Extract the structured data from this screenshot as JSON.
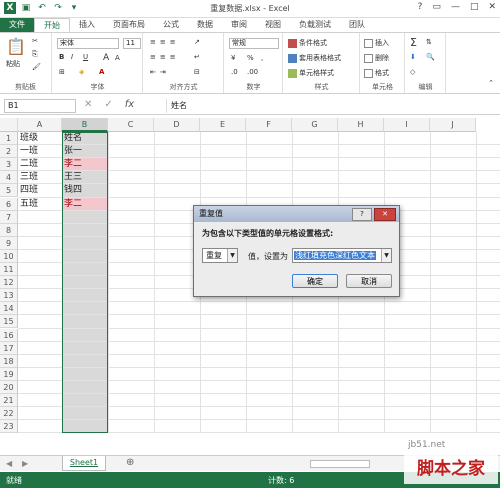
{
  "app": {
    "title": "重复数据.xlsx - Excel"
  },
  "window_controls": {
    "help": "?",
    "restore": "▭",
    "minimize": "—",
    "maximize": "□",
    "close": "✕"
  },
  "tabs": [
    "文件",
    "开始",
    "插入",
    "页面布局",
    "公式",
    "数据",
    "审阅",
    "视图",
    "负载测试",
    "团队"
  ],
  "ribbon": {
    "clipboard": {
      "label": "剪贴板",
      "paste": "粘贴"
    },
    "font": {
      "label": "字体",
      "name": "宋体",
      "size": "11",
      "bold": "B",
      "italic": "I",
      "underline": "U",
      "grow": "A",
      "shrink": "A",
      "color": "A"
    },
    "alignment": {
      "label": "对齐方式"
    },
    "number": {
      "label": "数字",
      "format": "常规",
      "percent": "%",
      "comma": ","
    },
    "styles": {
      "label": "样式",
      "cond": "条件格式",
      "table": "套用表格格式",
      "cell": "单元格样式"
    },
    "cells": {
      "label": "单元格",
      "insert": "插入",
      "delete": "删除",
      "format": "格式"
    },
    "editing": {
      "label": "编辑"
    }
  },
  "formula_bar": {
    "name_box": "B1",
    "fx": "fx",
    "cancel": "✕",
    "enter": "✓",
    "formula": "姓名"
  },
  "columns": [
    "A",
    "B",
    "C",
    "D",
    "E",
    "F",
    "G",
    "H",
    "I",
    "J"
  ],
  "rows": [
    "1",
    "2",
    "3",
    "4",
    "5",
    "6",
    "7",
    "8",
    "9",
    "10",
    "11",
    "12",
    "13",
    "14",
    "15",
    "16",
    "17",
    "18",
    "19",
    "20",
    "21",
    "22",
    "23"
  ],
  "cells": {
    "A": [
      "班级",
      "一班",
      "二班",
      "三班",
      "四班",
      "五班"
    ],
    "B": [
      "姓名",
      "张一",
      "李二",
      "王三",
      "钱四",
      "李二"
    ]
  },
  "dialog": {
    "title": "重复值",
    "instruction": "为包含以下类型值的单元格设置格式:",
    "type_value": "重复",
    "mid_label": "值，设置为",
    "format_value": "浅红填充色深红色文本",
    "ok": "确定",
    "cancel": "取消"
  },
  "sheet_tabs": {
    "active": "Sheet1",
    "add": "⊕"
  },
  "status": {
    "ready": "就绪",
    "count": "计数: 6"
  },
  "watermark": {
    "site": "jb51.net",
    "text": "脚本之家"
  },
  "colors": {
    "accent": "#217346",
    "dup_fill": "#f4c7ce",
    "dup_text": "#9c0006"
  }
}
